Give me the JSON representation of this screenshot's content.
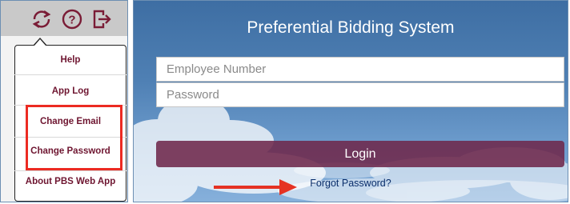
{
  "toolbar": {
    "icons": [
      "refresh-icon",
      "help-icon",
      "logout-icon"
    ]
  },
  "menu": {
    "items": [
      {
        "label": "Help"
      },
      {
        "label": "App Log"
      },
      {
        "label": "Change Email"
      },
      {
        "label": "Change Password"
      },
      {
        "label": "About PBS Web App"
      }
    ]
  },
  "login": {
    "title": "Preferential Bidding System",
    "employee_placeholder": "Employee Number",
    "password_placeholder": "Password",
    "login_label": "Login",
    "forgot_label": "Forgot Password?"
  },
  "colors": {
    "menu_text": "#6e1530",
    "highlight": "#ec2b22",
    "login_button": "#6e284b",
    "link": "#0a2e6b",
    "sky": "#4f80b4"
  }
}
